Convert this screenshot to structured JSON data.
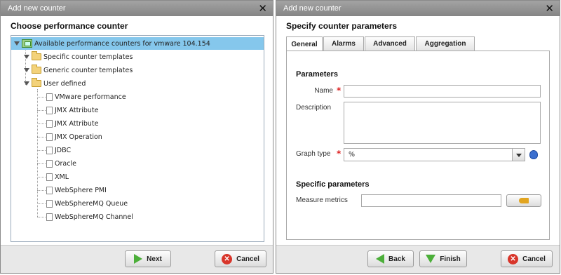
{
  "left_dialog": {
    "title": "Add new counter",
    "close": "✕",
    "heading": "Choose performance counter",
    "tree": {
      "root": "Available performance counters for vmware 104.154",
      "folders": [
        "Specific counter templates",
        "Generic counter templates",
        "User defined"
      ],
      "user_defined_items": [
        "VMware performance",
        "JMX Attribute",
        "JMX Attribute",
        "JMX Operation",
        "JDBC",
        "Oracle",
        "XML",
        "WebSphere PMI",
        "WebSphereMQ Queue",
        "WebSphereMQ Channel"
      ]
    },
    "buttons": {
      "next": "Next",
      "cancel": "Cancel"
    }
  },
  "right_dialog": {
    "title": "Add new counter",
    "close": "✕",
    "heading": "Specify counter parameters",
    "tabs": [
      "General",
      "Alarms",
      "Advanced",
      "Aggregation"
    ],
    "active_tab": "General",
    "parameters_heading": "Parameters",
    "fields": {
      "name_label": "Name",
      "name_value": "",
      "required_mark": "*",
      "description_label": "Description",
      "description_value": "",
      "graph_type_label": "Graph type",
      "graph_type_value": "%"
    },
    "specific_heading": "Specific parameters",
    "measure_metrics_label": "Measure metrics",
    "measure_metrics_value": "",
    "buttons": {
      "back": "Back",
      "finish": "Finish",
      "cancel": "Cancel"
    }
  },
  "colors": {
    "selection": "#85c7ec",
    "title_bar": "#959595",
    "required": "#dd2222",
    "accent_green": "#4caf3a"
  }
}
